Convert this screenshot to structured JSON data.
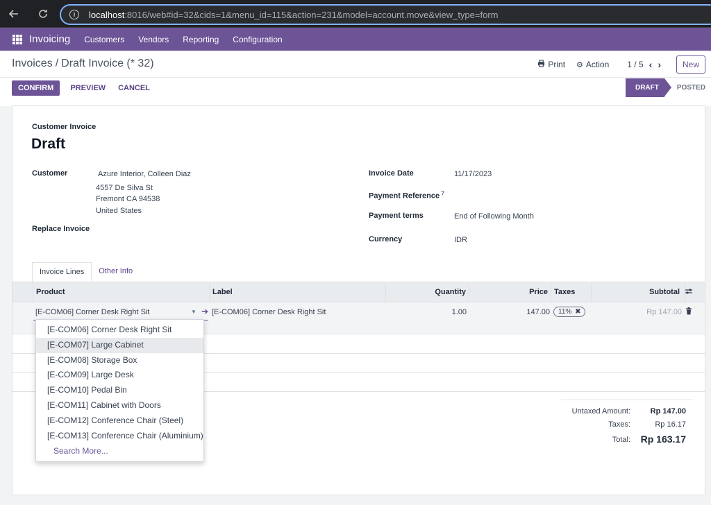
{
  "browser": {
    "url_host": "localhost",
    "url_rest": ":8016/web#id=32&cids=1&menu_id=115&action=231&model=account.move&view_type=form"
  },
  "navbar": {
    "app_title": "Invoicing",
    "menus": [
      "Customers",
      "Vendors",
      "Reporting",
      "Configuration"
    ]
  },
  "breadcrumb": {
    "parent": "Invoices",
    "separator": "/",
    "current": "Draft Invoice (* 32)"
  },
  "control": {
    "print_label": "Print",
    "action_label": "Action",
    "pager": "1 / 5",
    "new_label": "New"
  },
  "actions": {
    "confirm": "CONFIRM",
    "preview": "PREVIEW",
    "cancel": "CANCEL"
  },
  "status": {
    "draft": "DRAFT",
    "posted": "POSTED"
  },
  "form": {
    "doc_type": "Customer Invoice",
    "title": "Draft",
    "customer_label": "Customer",
    "customer_name": "Azure Interior, Colleen Diaz",
    "address_line1": "4557 De Silva St",
    "address_line2": "Fremont CA 94538",
    "address_line3": "United States",
    "replace_invoice_label": "Replace Invoice",
    "invoice_date_label": "Invoice Date",
    "invoice_date": "11/17/2023",
    "payment_ref_label": "Payment Reference",
    "payment_ref_help": "?",
    "payment_terms_label": "Payment terms",
    "payment_terms": "End of Following Month",
    "currency_label": "Currency",
    "currency": "IDR"
  },
  "tabs": {
    "lines": "Invoice Lines",
    "other": "Other Info"
  },
  "table": {
    "headers": {
      "product": "Product",
      "label": "Label",
      "quantity": "Quantity",
      "price": "Price",
      "taxes": "Taxes",
      "subtotal": "Subtotal"
    },
    "row": {
      "product": "[E-COM06] Corner Desk Right Sit",
      "label": "[E-COM06] Corner Desk Right Sit",
      "quantity": "1.00",
      "price": "147.00",
      "tax": "11%",
      "subtotal": "Rp 147.00"
    }
  },
  "dropdown": {
    "items": [
      "[E-COM06] Corner Desk Right Sit",
      "[E-COM07] Large Cabinet",
      "[E-COM08] Storage Box",
      "[E-COM09] Large Desk",
      "[E-COM10] Pedal Bin",
      "[E-COM11] Cabinet with Doors",
      "[E-COM12] Conference Chair (Steel)",
      "[E-COM13] Conference Chair (Aluminium)"
    ],
    "highlighted_index": 1,
    "search_more": "Search More..."
  },
  "totals": {
    "untaxed_label": "Untaxed Amount:",
    "untaxed": "Rp 147.00",
    "taxes_label": "Taxes:",
    "taxes": "Rp 16.17",
    "total_label": "Total:",
    "total": "Rp 163.17"
  },
  "colors": {
    "brand": "#6c5497",
    "browser_bg": "#202124"
  },
  "icons": {
    "back": "arrow-left-icon",
    "reload": "reload-icon",
    "info": "info-icon",
    "apps": "apps-grid-icon",
    "print": "printer-icon",
    "action": "gear-icon",
    "prev": "chevron-left-icon",
    "next": "chevron-right-icon",
    "dropdown": "caret-down-icon",
    "open": "arrow-right-icon",
    "remove_tax": "close-icon",
    "delete": "trash-icon",
    "columns": "sliders-icon"
  }
}
